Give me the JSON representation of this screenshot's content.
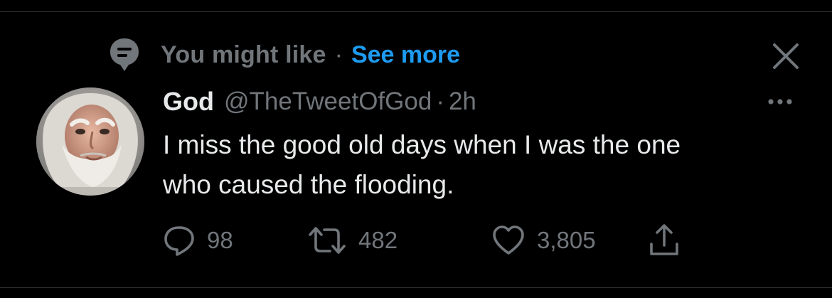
{
  "context": {
    "label": "You might like",
    "separator": "·",
    "link": "See more",
    "icon": "topic-bubble-icon",
    "link_color": "#1d9bf0"
  },
  "tweet": {
    "name": "God",
    "handle": "@TheTweetOfGod",
    "separator": "·",
    "time": "2h",
    "text_line1": "I miss the good old days when I was the one",
    "text_line2": "who caused the flooding."
  },
  "actions": {
    "reply": {
      "icon": "reply-icon",
      "count": "98"
    },
    "retweet": {
      "icon": "retweet-icon",
      "count": "482"
    },
    "like": {
      "icon": "heart-icon",
      "count": "3,805"
    },
    "share": {
      "icon": "share-icon"
    }
  },
  "colors": {
    "background": "#000000",
    "primary_text": "#e7e9ea",
    "secondary_text": "#71767b",
    "accent": "#1d9bf0",
    "divider": "#2f3336"
  }
}
